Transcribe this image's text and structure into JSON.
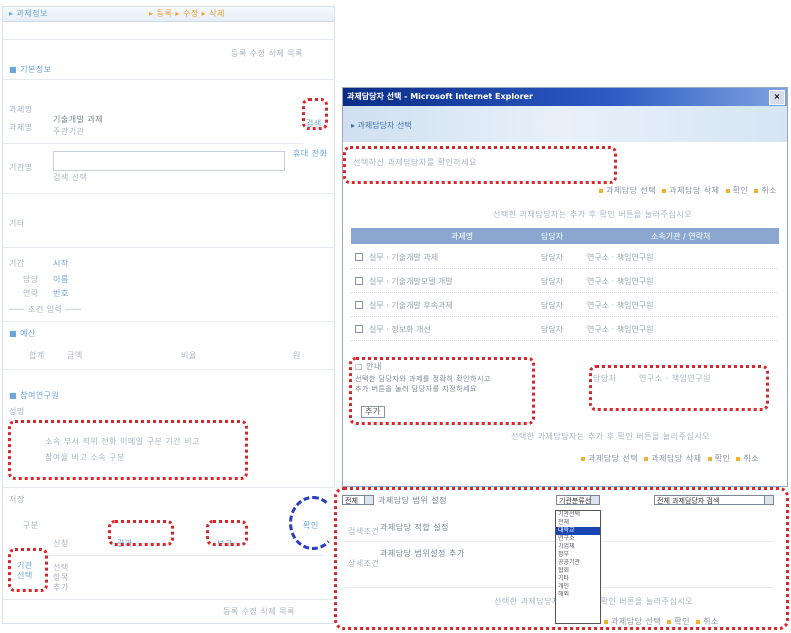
{
  "colors": {
    "highlight_dotted": "#d8262a",
    "callout_dashed": "#2a3fc0",
    "popup_titlebar": "#0a2c86",
    "table_header": "#8aa8cf",
    "list_selected": "#1a46b4",
    "bullet": "#f0b030"
  },
  "left": {
    "heading": "▸ 과제정보",
    "top_links": "▸ 등록  ▸ 수정  ▸ 삭제",
    "top_right_links": "등록 수정 삭제 목록",
    "section_basic": "■ 기본정보",
    "field1_label": "과제명",
    "field1_value": "기술개발 과제",
    "field1_sub": "주관기관",
    "search_button": "검색",
    "field2_label": "기관명",
    "field2_hint": "검색 선택",
    "field2_note": "휴대 전화",
    "misc_label": "기타",
    "rows": [
      {
        "a": "기간",
        "b": "시작"
      },
      {
        "a": "담당",
        "b": "이름"
      },
      {
        "a": "연락",
        "b": "번호"
      }
    ],
    "extra_row": "─── 조건 입력 ───",
    "section_budget": "■ 예산",
    "budget_row": {
      "a": "합계",
      "b": "금액",
      "c": "비율",
      "d": "원"
    },
    "section_member": "■ 참여연구원",
    "member_head": "성명",
    "member_rows": "소속  부서  직위  전화  이메일  구분  기간  비고",
    "member_rows2": "참여율  비고                소속 구분",
    "bottom_label": "저장",
    "bottom_items": [
      "구분",
      "신청",
      "결과",
      "보고"
    ],
    "bottom_left_box": "기관\n선택",
    "bottom_left_text": "선택\n항목\n추가",
    "footer_links": "등록 수정 삭제 목록",
    "callout_label": "확인"
  },
  "popup": {
    "title": "과제담당자 선택 - Microsoft Internet Explorer",
    "close": "×",
    "banner_label": "▸ 과제담당자 선택",
    "notice": "선택하신 과제담당자를 확인하세요",
    "top_actions": [
      "과제담당 선택",
      "과제담당 삭제",
      "확인",
      "취소"
    ],
    "info_line": "선택한 과제담당자는 추가 후 확인 버튼을 눌러주십시오",
    "columns": [
      "과제명",
      "담당자",
      "소속기관 / 연락처"
    ],
    "rows": [
      {
        "name": "실무 · 기술개발 과제",
        "person": "담당자",
        "org": "연구소 · 책임연구원"
      },
      {
        "name": "실무 · 기술개발모델 개발",
        "person": "담당자",
        "org": "연구소 · 책임연구원"
      },
      {
        "name": "실무 · 기술개발 후속과제",
        "person": "담당자",
        "org": "연구소 · 책임연구원"
      },
      {
        "name": "실무 · 정보화 개선",
        "person": "담당자",
        "org": "연구소 · 책임연구원"
      }
    ],
    "note_title": "□ 안내",
    "note_body": "선택한 담당자와 과제를 정확히 확인하시고\n추가 버튼을 눌러 담당자를 지정하세요",
    "note_button": "추가",
    "bottom_info": "선택한 과제담당자는 추가 후 확인 버튼을 눌러주십시오",
    "bottom_actions": [
      "과제담당 선택",
      "과제담당 삭제",
      "확인",
      "취소"
    ]
  },
  "search": {
    "scope_select": "전체",
    "row1_label": "과제담당 범위 설정",
    "category_select": "기관분류선택",
    "detail_select": "전체 과제담당자 검색",
    "row2_left": "검색조건",
    "row2_label": "과제담당 적합 설정",
    "row3_left": "상세조건",
    "row3_label": "과제담당 범위설정 추가",
    "info": "선택한 과제담당자는 추가 후 확인 버튼을 눌러주십시오",
    "actions": [
      "과제담당 선택",
      "확인",
      "취소"
    ],
    "dropdown_options": [
      "기관선택",
      "전체",
      "대학교",
      "연구소",
      "기업체",
      "정부",
      "공공기관",
      "협회",
      "기타",
      "개인",
      "해외"
    ],
    "dropdown_selected_index": 2
  }
}
